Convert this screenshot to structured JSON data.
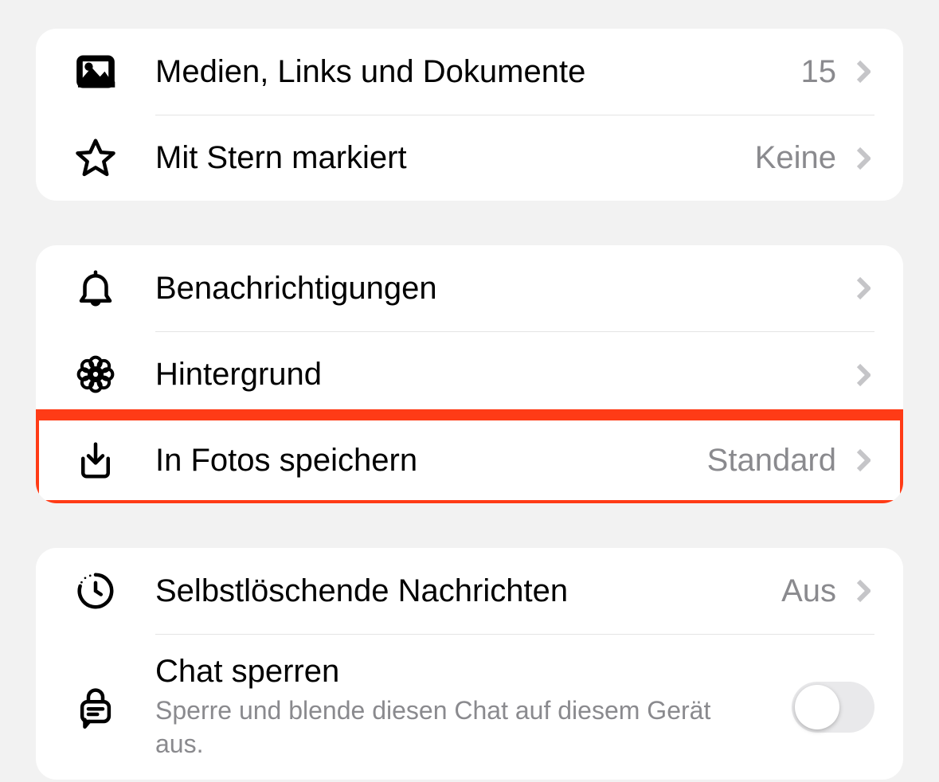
{
  "group1": {
    "media": {
      "label": "Medien, Links und Dokumente",
      "value": "15"
    },
    "starred": {
      "label": "Mit Stern markiert",
      "value": "Keine"
    }
  },
  "group2": {
    "notifications": {
      "label": "Benachrichtigungen"
    },
    "wallpaper": {
      "label": "Hintergrund"
    },
    "save_photos": {
      "label": "In Fotos speichern",
      "value": "Standard"
    }
  },
  "group3": {
    "disappearing": {
      "label": "Selbstlöschende Nachrichten",
      "value": "Aus"
    },
    "lock_chat": {
      "title": "Chat sperren",
      "subtitle": "Sperre und blende diesen Chat auf diesem Gerät aus."
    }
  }
}
